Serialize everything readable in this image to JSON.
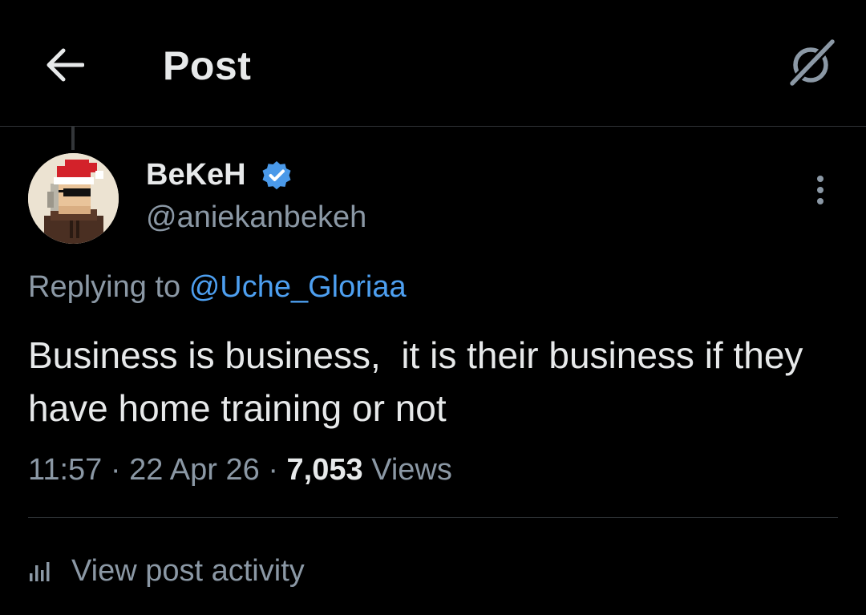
{
  "header": {
    "back_icon": "arrow-left-icon",
    "title": "Post",
    "grok_icon": "grok-slash-icon"
  },
  "post": {
    "author": {
      "display_name": "BeKeH",
      "username": "@aniekanbekeh",
      "verified": true,
      "verified_color": "#4a99e9",
      "avatar_icon": "pixel-avatar-santa-hat"
    },
    "more_icon": "more-vertical-icon",
    "reply": {
      "prefix": "Replying to",
      "mention": "@Uche_Gloriaa"
    },
    "text": "Business is business,  it is their business if they have home training or not",
    "meta": {
      "time": "11:57",
      "separator1": "·",
      "date": "22 Apr 26",
      "separator2": "·",
      "views_count": "7,053",
      "views_label": "Views"
    },
    "activity": {
      "icon": "bar-chart-icon",
      "label": "View post activity"
    }
  },
  "colors": {
    "background": "#000000",
    "text_primary": "#e7e9ea",
    "text_secondary": "#8b98a5",
    "link": "#4d9ff0",
    "divider": "#2f3336"
  }
}
